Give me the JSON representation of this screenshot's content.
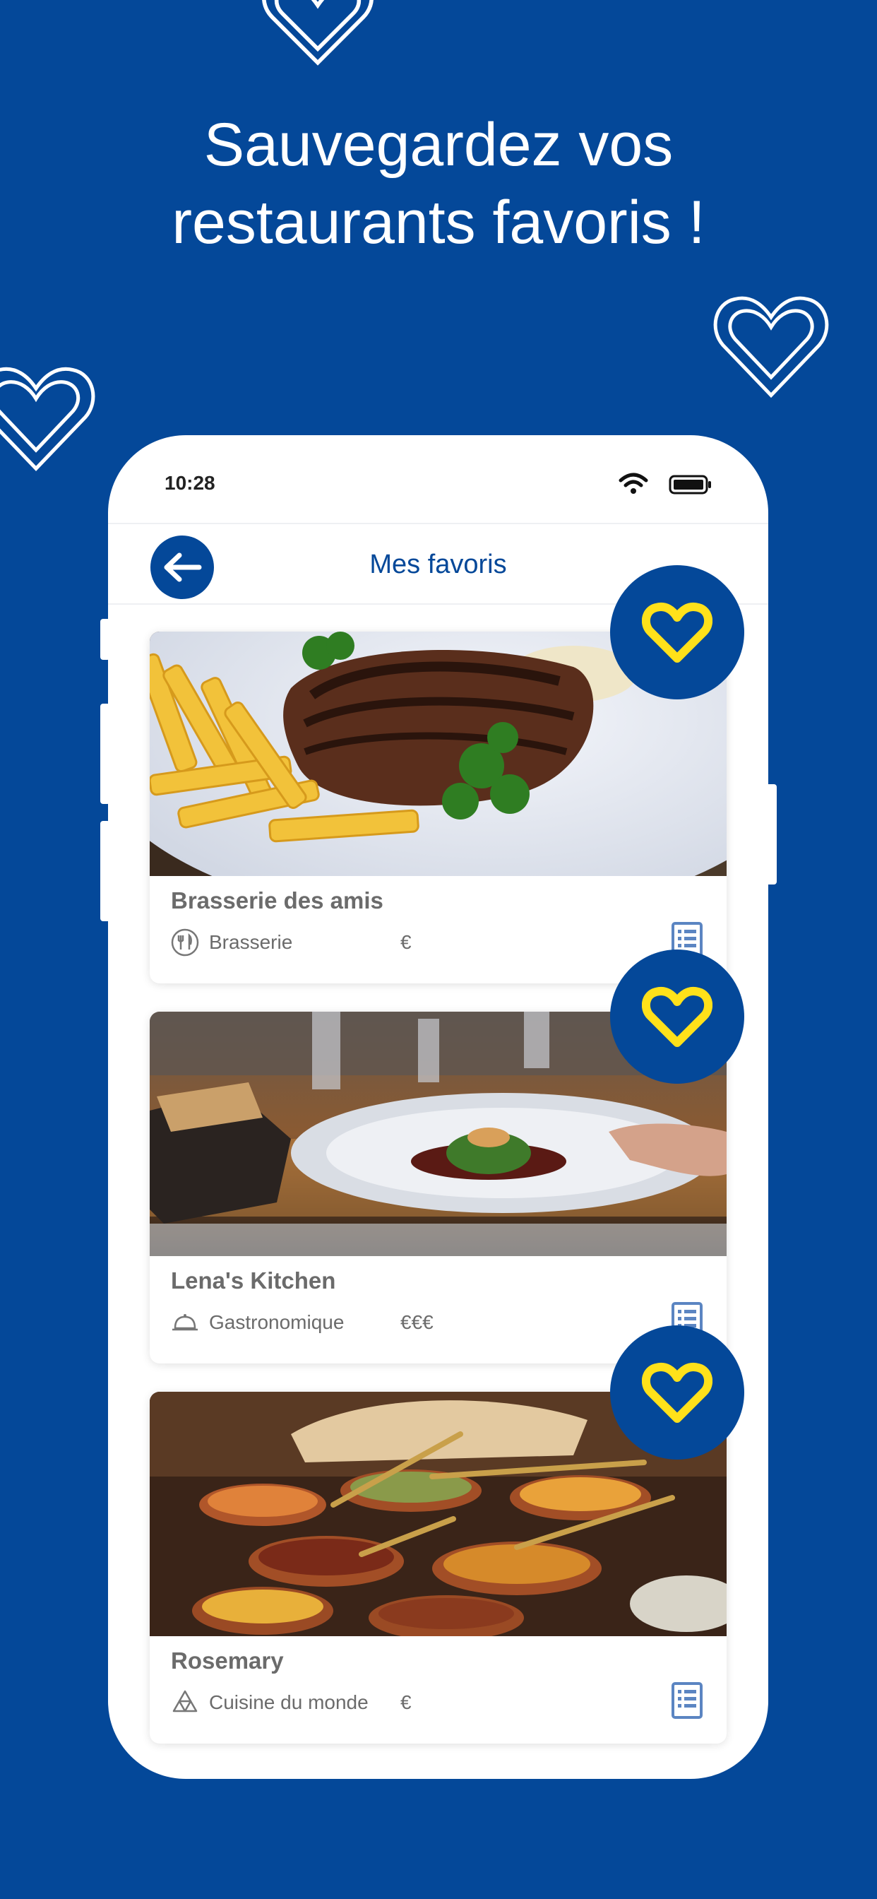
{
  "headline": {
    "line1": "Sauvegardez vos",
    "line2": "restaurants favoris !"
  },
  "colors": {
    "background": "#044899",
    "accent_yellow": "#FFE11A",
    "card_text": "#6b6b6b",
    "nav_title": "#044899"
  },
  "phone": {
    "status": {
      "time": "10:28",
      "wifi_icon": "wifi-icon",
      "battery_icon": "battery-icon"
    },
    "nav": {
      "back_icon": "arrow-left-icon",
      "title": "Mes favoris"
    },
    "favorites": [
      {
        "name": "Brasserie des amis",
        "category": "Brasserie",
        "category_icon": "cutlery-icon",
        "price": "€",
        "photo": "steak and fries",
        "menu_icon": "menu-document-icon",
        "favorite_icon": "heart-icon"
      },
      {
        "name": "Lena's Kitchen",
        "category": "Gastronomique",
        "category_icon": "cloche-icon",
        "price": "€€€",
        "photo": "fine dining plate",
        "menu_icon": "menu-document-icon",
        "favorite_icon": "heart-icon"
      },
      {
        "name": "Rosemary",
        "category": "Cuisine du monde",
        "category_icon": "world-cuisine-icon",
        "price": "€",
        "photo": "curry pots",
        "menu_icon": "menu-document-icon",
        "favorite_icon": "heart-icon"
      }
    ]
  }
}
